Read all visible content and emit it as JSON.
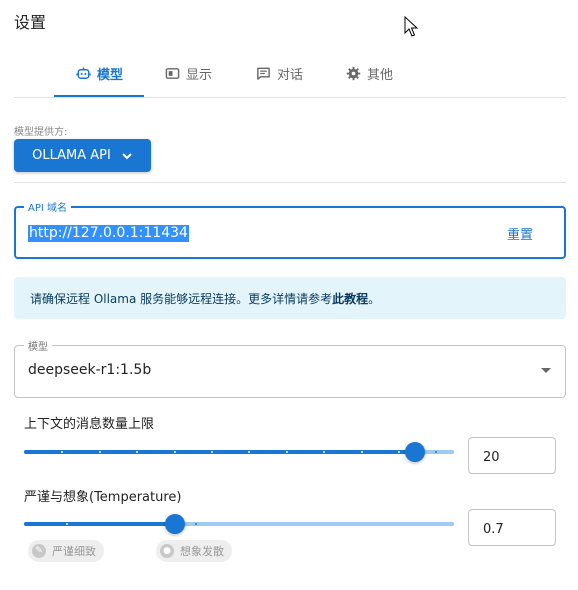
{
  "page_title": "设置",
  "tabs": [
    {
      "label": "模型",
      "icon": "robot-icon",
      "active": true
    },
    {
      "label": "显示",
      "icon": "display-icon",
      "active": false
    },
    {
      "label": "对话",
      "icon": "chat-icon",
      "active": false
    },
    {
      "label": "其他",
      "icon": "gear-icon",
      "active": false
    }
  ],
  "provider": {
    "label": "模型提供方:",
    "value": "OLLAMA API"
  },
  "api_host": {
    "label": "API 域名",
    "value": "http://127.0.0.1:11434",
    "reset_label": "重置"
  },
  "info": {
    "text": "请确保远程 Ollama 服务能够远程连接。更多详情请参考",
    "link": "此教程",
    "suffix": "。"
  },
  "model": {
    "label": "模型",
    "value": "deepseek-r1:1.5b"
  },
  "context_slider": {
    "title": "上下文的消息数量上限",
    "value": "20",
    "fraction": 0.91
  },
  "temperature_slider": {
    "title": "严谨与想象(Temperature)",
    "value": "0.7",
    "fraction": 0.35,
    "marks": [
      {
        "label": "严谨细致"
      },
      {
        "label": "想象发散"
      }
    ]
  },
  "colors": {
    "accent": "#1976d2",
    "info_bg": "#e3f4fb",
    "selection": "#3390ff"
  }
}
